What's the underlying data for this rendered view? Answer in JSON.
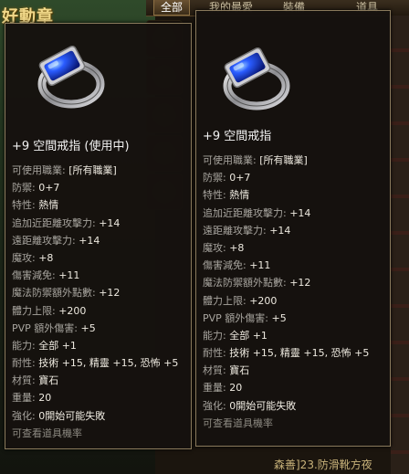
{
  "background": {
    "title_fragment": "好動章",
    "tabs": [
      "全部",
      "我的最愛",
      "裝備",
      "道具"
    ],
    "bottom_text": "森善]23.防滑靴方夜",
    "colors": {
      "title": "#f1d98a",
      "panel": "#1b150e"
    }
  },
  "tooltips": [
    {
      "id": "equipped",
      "icon": "blue-gem-ring-icon",
      "name": "+9 空間戒指 (使用中)",
      "stats": [
        {
          "label": "可使用職業:",
          "value": "[所有職業]"
        },
        {
          "label": "防禦:",
          "value": "0+7"
        },
        {
          "label": "特性:",
          "value": "熱情"
        },
        {
          "label": "追加近距離攻擊力:",
          "value": "+14"
        },
        {
          "label": "遠距離攻擊力:",
          "value": "+14"
        },
        {
          "label": "魔攻:",
          "value": "+8"
        },
        {
          "label": "傷害減免:",
          "value": "+11"
        },
        {
          "label": "魔法防禦額外點數:",
          "value": "+12"
        },
        {
          "label": "體力上限:",
          "value": "+200"
        },
        {
          "label": "PVP 額外傷害:",
          "value": "+5"
        },
        {
          "label": "能力:",
          "value": "全部 +1"
        },
        {
          "label": "耐性:",
          "value": "技術 +15, 精靈 +15, 恐怖 +5"
        },
        {
          "label": "材質:",
          "value": "寶石"
        },
        {
          "label": "重量:",
          "value": "20"
        },
        {
          "label": "強化:",
          "value": "0開始可能失敗"
        }
      ],
      "hint": "可查看道具機率"
    },
    {
      "id": "compare",
      "icon": "blue-gem-ring-icon",
      "name": "+9 空間戒指",
      "stats": [
        {
          "label": "可使用職業:",
          "value": "[所有職業]"
        },
        {
          "label": "防禦:",
          "value": "0+7"
        },
        {
          "label": "特性:",
          "value": "熱情"
        },
        {
          "label": "追加近距離攻擊力:",
          "value": "+14"
        },
        {
          "label": "遠距離攻擊力:",
          "value": "+14"
        },
        {
          "label": "魔攻:",
          "value": "+8"
        },
        {
          "label": "傷害減免:",
          "value": "+11"
        },
        {
          "label": "魔法防禦額外點數:",
          "value": "+12"
        },
        {
          "label": "體力上限:",
          "value": "+200"
        },
        {
          "label": "PVP 額外傷害:",
          "value": "+5"
        },
        {
          "label": "能力:",
          "value": "全部 +1"
        },
        {
          "label": "耐性:",
          "value": "技術 +15, 精靈 +15, 恐怖 +5"
        },
        {
          "label": "材質:",
          "value": "寶石"
        },
        {
          "label": "重量:",
          "value": "20"
        },
        {
          "label": "強化:",
          "value": "0開始可能失敗"
        }
      ],
      "hint": "可查看道具機率"
    }
  ]
}
